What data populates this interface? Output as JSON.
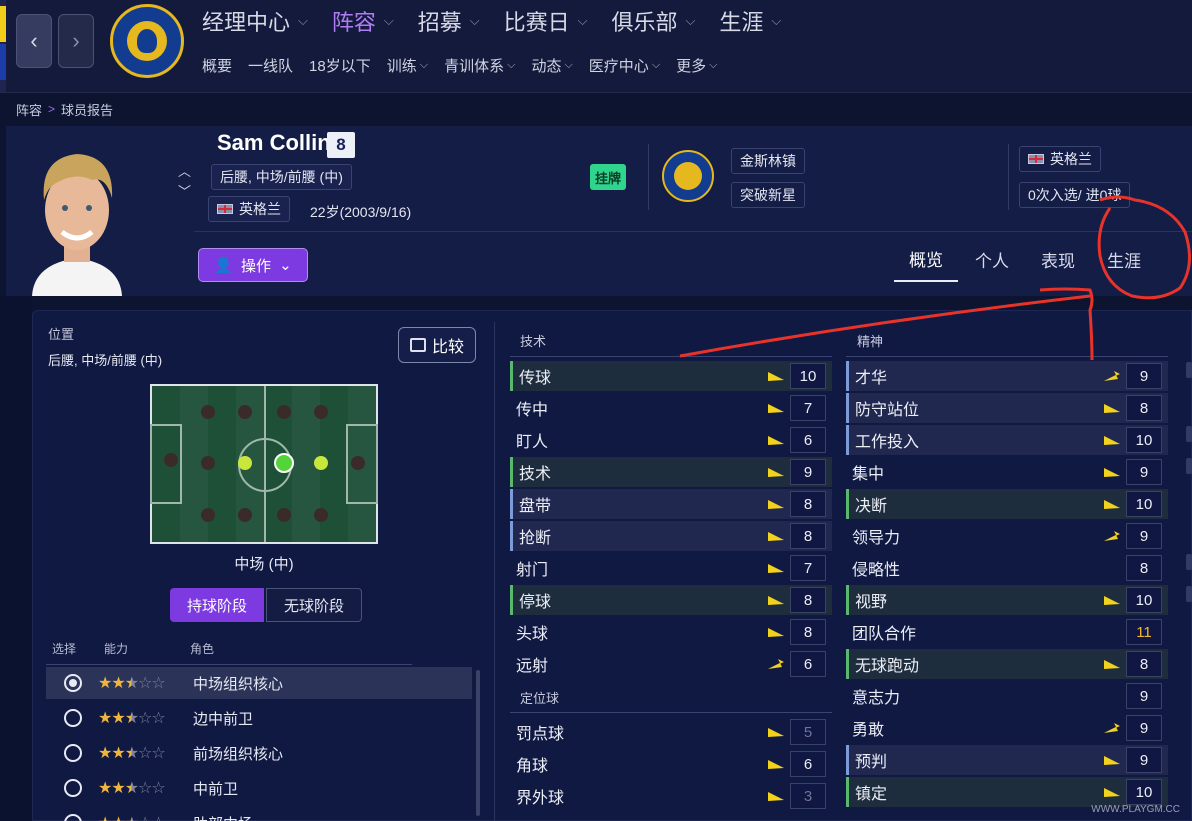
{
  "nav": {
    "back_icon": "chevron-left-icon",
    "forward_icon": "chevron-right-icon",
    "main_menu": [
      "经理中心",
      "阵容",
      "招募",
      "比赛日",
      "俱乐部",
      "生涯"
    ],
    "main_menu_active": "阵容",
    "sub_menu": [
      {
        "label": "概要",
        "dropdown": false
      },
      {
        "label": "一线队",
        "dropdown": false
      },
      {
        "label": "18岁以下",
        "dropdown": false
      },
      {
        "label": "训练",
        "dropdown": true
      },
      {
        "label": "青训体系",
        "dropdown": true
      },
      {
        "label": "动态",
        "dropdown": true
      },
      {
        "label": "医疗中心",
        "dropdown": true
      },
      {
        "label": "更多",
        "dropdown": true
      }
    ]
  },
  "breadcrumb": {
    "parent": "阵容",
    "current": "球员报告"
  },
  "player": {
    "name": "Sam Collins",
    "number": "8",
    "position": "后腰, 中场/前腰 (中)",
    "nationality": "英格兰",
    "age": "22岁(2003/9/16)",
    "status_tag": "挂牌",
    "club": "金斯林镇",
    "club_status": "突破新星",
    "nation_team": "英格兰",
    "caps": "0次入选/ 进0球",
    "ops_label": "操作"
  },
  "tabs": [
    "概览",
    "个人",
    "表现",
    "生涯"
  ],
  "tabs_active": "概览",
  "position_panel": {
    "title": "位置",
    "value": "后腰, 中场/前腰 (中)",
    "compare_label": "比较",
    "pitch_label": "中场 (中)",
    "phase_on": "持球阶段",
    "phase_off": "无球阶段",
    "col_select": "选择",
    "col_ability": "能力",
    "col_role": "角色",
    "roles": [
      {
        "name": "中场组织核心",
        "stars": 2.5,
        "selected": true
      },
      {
        "name": "边中前卫",
        "stars": 2.5,
        "selected": false
      },
      {
        "name": "前场组织核心",
        "stars": 2.5,
        "selected": false
      },
      {
        "name": "中前卫",
        "stars": 2.5,
        "selected": false
      },
      {
        "name": "肋部中场",
        "stars": 2.5,
        "selected": false
      }
    ]
  },
  "technical": {
    "title": "技术",
    "attrs": [
      {
        "name": "传球",
        "value": "10",
        "hl": "green",
        "arrow": "flat"
      },
      {
        "name": "传中",
        "value": "7",
        "hl": "none",
        "arrow": "flat"
      },
      {
        "name": "盯人",
        "value": "6",
        "hl": "none",
        "arrow": "flat"
      },
      {
        "name": "技术",
        "value": "9",
        "hl": "green",
        "arrow": "flat"
      },
      {
        "name": "盘带",
        "value": "8",
        "hl": "blue",
        "arrow": "flat"
      },
      {
        "name": "抢断",
        "value": "8",
        "hl": "blue",
        "arrow": "flat"
      },
      {
        "name": "射门",
        "value": "7",
        "hl": "none",
        "arrow": "flat"
      },
      {
        "name": "停球",
        "value": "8",
        "hl": "green",
        "arrow": "flat"
      },
      {
        "name": "头球",
        "value": "8",
        "hl": "none",
        "arrow": "flat"
      },
      {
        "name": "远射",
        "value": "6",
        "hl": "none",
        "arrow": "up"
      }
    ]
  },
  "set_pieces": {
    "title": "定位球",
    "attrs": [
      {
        "name": "罚点球",
        "value": "5",
        "dim": true,
        "arrow": "flat"
      },
      {
        "name": "角球",
        "value": "6",
        "dim": false,
        "arrow": "flat"
      },
      {
        "name": "界外球",
        "value": "3",
        "dim": true,
        "arrow": "flat"
      }
    ]
  },
  "mental": {
    "title": "精神",
    "attrs": [
      {
        "name": "才华",
        "value": "9",
        "hl": "blue",
        "arrow": "up"
      },
      {
        "name": "防守站位",
        "value": "8",
        "hl": "blue",
        "arrow": "flat"
      },
      {
        "name": "工作投入",
        "value": "10",
        "hl": "blue",
        "arrow": "flat"
      },
      {
        "name": "集中",
        "value": "9",
        "hl": "none",
        "arrow": "flat"
      },
      {
        "name": "决断",
        "value": "10",
        "hl": "green",
        "arrow": "flat"
      },
      {
        "name": "领导力",
        "value": "9",
        "hl": "none",
        "arrow": "up"
      },
      {
        "name": "侵略性",
        "value": "8",
        "hl": "none",
        "arrow": "none"
      },
      {
        "name": "视野",
        "value": "10",
        "hl": "green",
        "arrow": "flat"
      },
      {
        "name": "团队合作",
        "value": "11",
        "hl": "none",
        "arrow": "none",
        "gold": true
      },
      {
        "name": "无球跑动",
        "value": "8",
        "hl": "green",
        "arrow": "flat"
      },
      {
        "name": "意志力",
        "value": "9",
        "hl": "none",
        "arrow": "none"
      },
      {
        "name": "勇敢",
        "value": "9",
        "hl": "none",
        "arrow": "up"
      },
      {
        "name": "预判",
        "value": "9",
        "hl": "blue",
        "arrow": "flat"
      },
      {
        "name": "镇定",
        "value": "10",
        "hl": "green",
        "arrow": "flat"
      }
    ]
  },
  "colors": {
    "accent": "#7c3ae0",
    "arrow": "#f2d21b",
    "annotation": "#e8332a"
  },
  "watermark": "WWW.PLAYGM.CC"
}
